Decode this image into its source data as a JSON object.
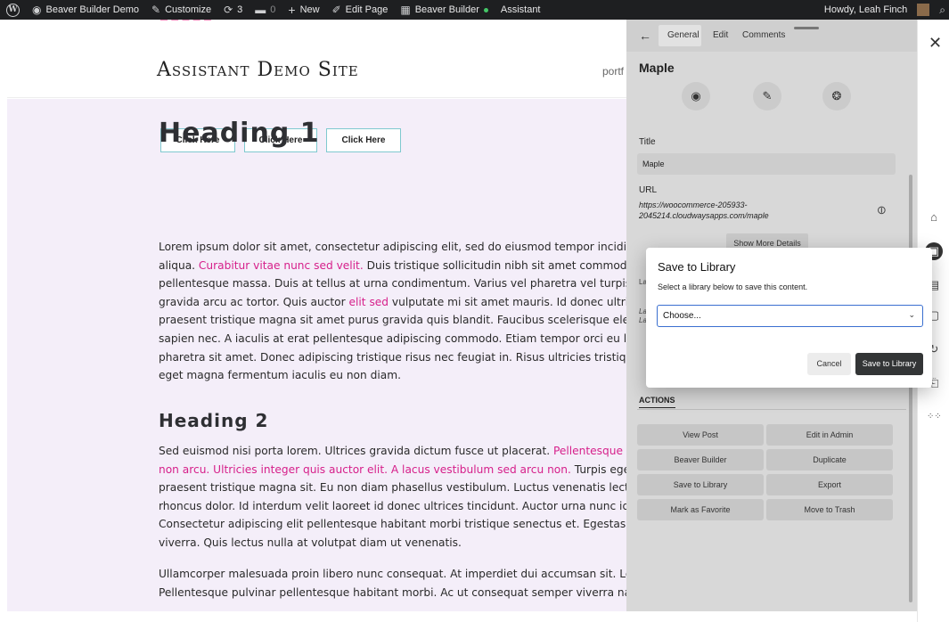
{
  "admin_bar": {
    "site_name": "Beaver Builder Demo",
    "customize": "Customize",
    "updates_count": "3",
    "comments_count": "0",
    "new": "New",
    "edit_page": "Edit Page",
    "beaver_builder": "Beaver Builder",
    "assistant": "Assistant",
    "greeting": "Howdy, Leah Finch"
  },
  "site": {
    "title": "Assistant Demo Site",
    "nav_partial": "portf",
    "buttons": [
      "Click Here",
      "Click Here",
      "Click Here"
    ],
    "heading1": "Heading 1",
    "heading2": "Heading 2",
    "para1": [
      "Lorem ipsum dolor sit amet, consectetur adipiscing elit, sed do eiusmod tempor incididu",
      [
        "aliqua. ",
        "Curabitur vitae nunc sed velit.",
        " Duis tristique sollicitudin nibh sit amet commodo. I"
      ],
      "pellentesque massa. Duis at tellus at urna condimentum. Varius vel pharetra vel turpis n",
      [
        "gravida arcu ac tortor. Quis auctor ",
        "elit sed",
        " vulputate mi sit amet mauris. Id donec ultrices"
      ],
      "praesent tristique magna sit amet purus gravida quis blandit. Faucibus scelerisque eleife",
      "sapien nec. A iaculis at erat pellentesque adipiscing commodo. Etiam tempor orci eu lobo",
      "pharetra sit amet. Donec adipiscing tristique risus nec feugiat in. Risus ultricies tristique n",
      "eget magna fermentum iaculis eu non diam."
    ],
    "para2": [
      [
        "Sed euismod nisi porta lorem. Ultrices gravida dictum fusce ut placerat. ",
        "Pellentesque sit",
        ""
      ],
      [
        "",
        "non arcu. Ultricies integer quis auctor elit. A lacus vestibulum sed arcu non.",
        " Turpis egesta"
      ],
      "praesent tristique magna sit. Eu non diam phasellus vestibulum. Luctus venenatis lectus",
      "rhoncus dolor. Id interdum velit laoreet id donec ultrices tincidunt. Auctor urna nunc id c",
      "Consectetur adipiscing elit pellentesque habitant morbi tristique senectus et. Egestas dia",
      "viverra. Quis lectus nulla at volutpat diam ut venenatis."
    ],
    "para3": [
      "Ullamcorper malesuada proin libero nunc consequat. At imperdiet dui accumsan sit. Lect",
      "Pellentesque pulvinar pellentesque habitant morbi. Ac ut consequat semper viverra nam"
    ]
  },
  "panel": {
    "tabs": [
      "General",
      "Edit",
      "Comments"
    ],
    "item_title": "Maple",
    "title_label": "Title",
    "title_value": "Maple",
    "url_label": "URL",
    "url_value": "https://woocommerce-205933-2045214.cloudwaysapps.com/maple",
    "show_more": "Show More Details",
    "actions_label": "ACTIONS",
    "actions": [
      "View Post",
      "Edit in Admin",
      "Beaver Builder",
      "Duplicate",
      "Save to Library",
      "Export",
      "Mark as Favorite",
      "Move to Trash"
    ]
  },
  "modal": {
    "title": "Save to Library",
    "subtitle": "Select a library below to save this content.",
    "select_value": "Choose...",
    "cancel": "Cancel",
    "save": "Save to Library"
  }
}
